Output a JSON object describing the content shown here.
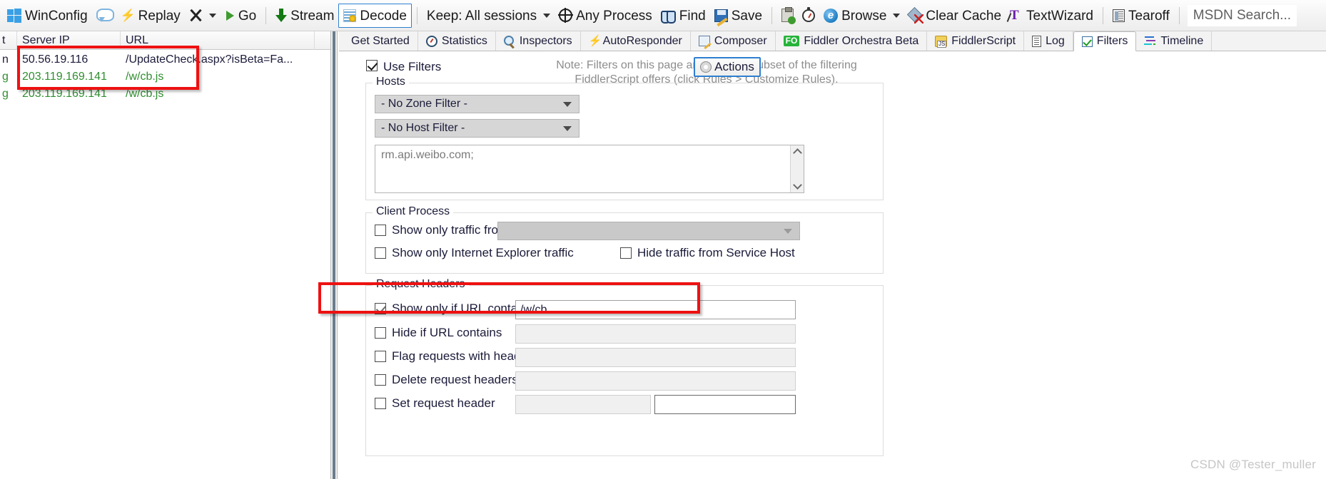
{
  "toolbar": {
    "items": [
      {
        "icon": "windows-logo-icon",
        "label": "WinConfig"
      },
      {
        "icon": "speech-bubble-icon",
        "label": ""
      },
      {
        "icon": "replay-icon",
        "label": "Replay"
      },
      {
        "icon": "remove-x-icon",
        "label": "",
        "caret": true
      },
      {
        "icon": "play-go-icon",
        "label": "Go"
      },
      {
        "icon": "stream-arrow-icon",
        "label": "Stream"
      },
      {
        "icon": "decode-icon",
        "label": "Decode",
        "boxed": true
      },
      {
        "icon": "",
        "label": "Keep: All sessions",
        "caret": true
      },
      {
        "icon": "target-icon",
        "label": "Any Process"
      },
      {
        "icon": "binoculars-icon",
        "label": "Find"
      },
      {
        "icon": "save-disk-icon",
        "label": "Save"
      },
      {
        "icon": "clipboard-add-icon",
        "label": ""
      },
      {
        "icon": "stopwatch-icon",
        "label": ""
      },
      {
        "icon": "internet-explorer-icon",
        "label": "Browse",
        "caret": true
      },
      {
        "icon": "clear-cache-icon",
        "label": "Clear Cache"
      },
      {
        "icon": "text-wizard-icon",
        "label": "TextWizard"
      },
      {
        "icon": "tearoff-icon",
        "label": "Tearoff"
      }
    ],
    "msdn_search": "MSDN Search..."
  },
  "sessions": {
    "columns": [
      "t",
      "Server IP",
      "URL",
      ""
    ],
    "col0_values": [
      "n",
      "g",
      "g"
    ],
    "rows": [
      {
        "flag": "n",
        "server_ip": "50.56.19.116",
        "url": "/UpdateCheck.aspx?isBeta=Fa...",
        "color": "black"
      },
      {
        "flag": "g",
        "server_ip": "203.119.169.141",
        "url": "/w/cb.js",
        "color": "green"
      },
      {
        "flag": "g",
        "server_ip": "203.119.169.141",
        "url": "/w/cb.js",
        "color": "green"
      }
    ]
  },
  "tabs": [
    {
      "label": "Get Started",
      "icon": "",
      "active": false
    },
    {
      "label": "Statistics",
      "icon": "statistics-icon",
      "active": false
    },
    {
      "label": "Inspectors",
      "icon": "inspectors-icon",
      "active": false
    },
    {
      "label": "AutoResponder",
      "icon": "autoresponder-icon",
      "active": false
    },
    {
      "label": "Composer",
      "icon": "composer-icon",
      "active": false
    },
    {
      "label": "Fiddler Orchestra Beta",
      "icon": "fiddler-orchestra-icon",
      "active": false
    },
    {
      "label": "FiddlerScript",
      "icon": "fiddlerscript-icon",
      "active": false
    },
    {
      "label": "Log",
      "icon": "log-icon",
      "active": false
    },
    {
      "label": "Filters",
      "icon": "filters-icon",
      "active": true
    },
    {
      "label": "Timeline",
      "icon": "timeline-icon",
      "active": false
    }
  ],
  "filters": {
    "use_filters_label": "Use Filters",
    "use_filters_checked": true,
    "note_line1": "Note: Filters on this page are a simple subset of the filtering",
    "note_line2": "FiddlerScript offers (click Rules > Customize Rules).",
    "actions_label": "Actions",
    "hosts": {
      "title": "Hosts",
      "zone_filter": "- No Zone Filter -",
      "host_filter": "- No Host Filter -",
      "host_list_value": "rm.api.weibo.com;"
    },
    "client_process": {
      "title": "Client Process",
      "show_only_traffic_from_label": "Show only traffic from",
      "show_only_traffic_from_checked": false,
      "process_combo_value": "",
      "show_only_ie_label": "Show only Internet Explorer traffic",
      "show_only_ie_checked": false,
      "hide_service_host_label": "Hide traffic from Service Host",
      "hide_service_host_checked": false
    },
    "request_headers": {
      "title": "Request Headers",
      "rows": [
        {
          "label": "Show only if URL contains",
          "checked": true,
          "value": "/w/cb",
          "enabled": true
        },
        {
          "label": "Hide if URL contains",
          "checked": false,
          "value": "",
          "enabled": false
        },
        {
          "label": "Flag requests with headers",
          "checked": false,
          "value": "",
          "enabled": false
        },
        {
          "label": "Delete request headers",
          "checked": false,
          "value": "",
          "enabled": false
        },
        {
          "label": "Set request header",
          "checked": false,
          "value": "",
          "value2": "",
          "enabled": false
        }
      ]
    }
  },
  "annotations": {
    "highlight_color": "#ee1111"
  },
  "watermark": "CSDN @Tester_muller"
}
